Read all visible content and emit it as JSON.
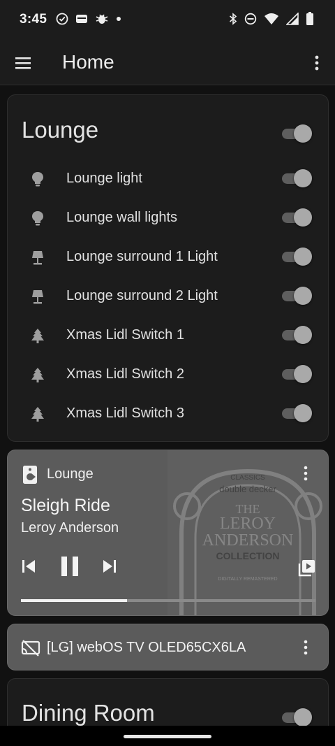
{
  "status_bar": {
    "time": "3:45",
    "left_icons": [
      "check-circle-icon",
      "wallet-icon",
      "bug-icon",
      "dot-icon"
    ],
    "right_icons": [
      "bluetooth-icon",
      "do-not-disturb-icon",
      "wifi-icon",
      "signal-icon",
      "battery-icon"
    ]
  },
  "app_bar": {
    "title": "Home",
    "icons": [
      "menu-icon",
      "more-vert-icon"
    ]
  },
  "lounge": {
    "title": "Lounge",
    "toggle_on": true,
    "entities": [
      {
        "label": "Lounge light",
        "icon": "bulb-icon",
        "on": true
      },
      {
        "label": "Lounge wall lights",
        "icon": "bulb-icon",
        "on": true
      },
      {
        "label": "Lounge surround 1 Light",
        "icon": "lamp-icon",
        "on": true
      },
      {
        "label": "Lounge surround 2 Light",
        "icon": "lamp-icon",
        "on": true
      },
      {
        "label": "Xmas Lidl Switch 1",
        "icon": "pine-tree-icon",
        "on": true
      },
      {
        "label": "Xmas Lidl Switch 2",
        "icon": "pine-tree-icon",
        "on": true
      },
      {
        "label": "Xmas Lidl Switch 3",
        "icon": "pine-tree-icon",
        "on": true
      }
    ]
  },
  "media_player": {
    "source": "Lounge",
    "song": "Sleigh Ride",
    "artist": "Leroy Anderson",
    "progress": 0.36,
    "album_art_text": {
      "line1": "CLASSICS",
      "line2": "double decker",
      "line3": "THE",
      "line4": "LEROY",
      "line5": "ANDERSON",
      "line6": "COLLECTION",
      "line7": "DIGITALLY REMASTERED"
    }
  },
  "tv": {
    "name": "[LG] webOS TV OLED65CX6LA"
  },
  "dining": {
    "title": "Dining Room",
    "toggle_on": true
  },
  "colors": {
    "background": "#111111",
    "card": "#1c1c1c",
    "media_card": "#5b5b5b",
    "toggle_thumb": "#a9a9a9",
    "toggle_track": "#5e5e5e"
  }
}
